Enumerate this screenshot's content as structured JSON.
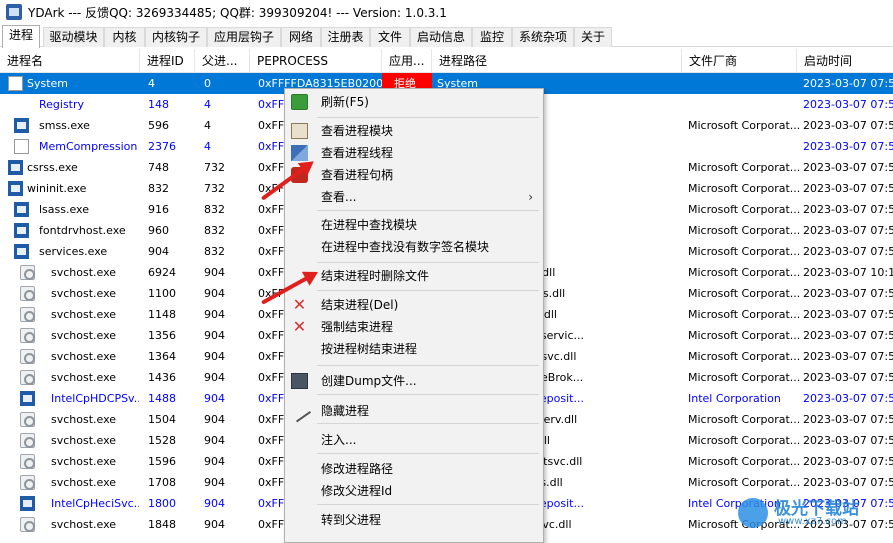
{
  "window": {
    "title": "YDArk --- 反馈QQ: 3269334485; QQ群: 399309204! --- Version: 1.0.3.1"
  },
  "tabs": [
    "进程",
    "驱动模块",
    "内核",
    "内核钩子",
    "应用层钩子",
    "网络",
    "注册表",
    "文件",
    "启动信息",
    "监控",
    "系统杂项",
    "关于"
  ],
  "columns": [
    "进程名",
    "进程ID",
    "父进...",
    "PEPROCESS",
    "应用...",
    "进程路径",
    "文件厂商",
    "启动时间"
  ],
  "rows": [
    {
      "name": "System",
      "pid": "4",
      "ppid": "0",
      "peprocess": "0xFFFFDA8315EB0200",
      "access": "拒绝",
      "path": "System",
      "vendor": "",
      "time": "2023-03-07 07:56:",
      "icon": "doc-icon",
      "blue": false,
      "selected": true
    },
    {
      "name": "Registry",
      "pid": "148",
      "ppid": "4",
      "peprocess": "0xFF",
      "access": "",
      "path": "",
      "vendor": "",
      "time": "2023-03-07 07:56:",
      "icon": "none",
      "blue": true,
      "selected": false
    },
    {
      "name": "smss.exe",
      "pid": "596",
      "ppid": "4",
      "peprocess": "0xFF",
      "access": "",
      "path": "2\\smss.exe",
      "vendor": "Microsoft Corporat...",
      "time": "2023-03-07 07:56:",
      "icon": "exe-icon",
      "blue": false,
      "selected": false
    },
    {
      "name": "MemCompression",
      "pid": "2376",
      "ppid": "4",
      "peprocess": "0xFF",
      "access": "",
      "path": "",
      "vendor": "",
      "time": "2023-03-07 07:56:",
      "icon": "doc-icon",
      "blue": true,
      "selected": false
    },
    {
      "name": "csrss.exe",
      "pid": "748",
      "ppid": "732",
      "peprocess": "0xFF",
      "access": "",
      "path": "2\\csrss.exe",
      "vendor": "Microsoft Corporat...",
      "time": "2023-03-07 07:56:",
      "icon": "exe-icon",
      "blue": false,
      "selected": false
    },
    {
      "name": "wininit.exe",
      "pid": "832",
      "ppid": "732",
      "peprocess": "0xFF",
      "access": "",
      "path": "2\\wininit.exe",
      "vendor": "Microsoft Corporat...",
      "time": "2023-03-07 07:56:",
      "icon": "exe-icon",
      "blue": false,
      "selected": false
    },
    {
      "name": "lsass.exe",
      "pid": "916",
      "ppid": "832",
      "peprocess": "0xFF",
      "access": "",
      "path": "2\\lsass.exe",
      "vendor": "Microsoft Corporat...",
      "time": "2023-03-07 07:56:",
      "icon": "exe-icon",
      "blue": false,
      "selected": false
    },
    {
      "name": "fontdrvhost.exe",
      "pid": "960",
      "ppid": "832",
      "peprocess": "0xFF",
      "access": "",
      "path": "2\\fontdrvhost.exe",
      "vendor": "Microsoft Corporat...",
      "time": "2023-03-07 07:56:",
      "icon": "exe-icon",
      "blue": false,
      "selected": false
    },
    {
      "name": "services.exe",
      "pid": "904",
      "ppid": "832",
      "peprocess": "0xFF",
      "access": "",
      "path": "2\\services.exe",
      "vendor": "Microsoft Corporat...",
      "time": "2023-03-07 07:56:",
      "icon": "exe-icon",
      "blue": false,
      "selected": false
    },
    {
      "name": "svchost.exe",
      "pid": "6924",
      "ppid": "904",
      "peprocess": "0xFF",
      "access": "",
      "path": "ows\\system32\\wdi.dll",
      "vendor": "Microsoft Corporat...",
      "time": "2023-03-07 10:18:",
      "icon": "svc-icon",
      "blue": false,
      "selected": false
    },
    {
      "name": "svchost.exe",
      "pid": "1100",
      "ppid": "904",
      "peprocess": "0xFF",
      "access": "",
      "path": "ows\\system32\\rpcss.dll",
      "vendor": "Microsoft Corporat...",
      "time": "2023-03-07 07:56:",
      "icon": "svc-icon",
      "blue": false,
      "selected": false
    },
    {
      "name": "svchost.exe",
      "pid": "1148",
      "ppid": "904",
      "peprocess": "0xFF",
      "access": "",
      "path": "ows\\System32\\lsm.dll",
      "vendor": "Microsoft Corporat...",
      "time": "2023-03-07 07:56:",
      "icon": "svc-icon",
      "blue": false,
      "selected": false
    },
    {
      "name": "svchost.exe",
      "pid": "1356",
      "ppid": "904",
      "peprocess": "0xFF",
      "access": "",
      "path": "ows\\System32\\ncbservic...",
      "vendor": "Microsoft Corporat...",
      "time": "2023-03-07 07:56:",
      "icon": "svc-icon",
      "blue": false,
      "selected": false
    },
    {
      "name": "svchost.exe",
      "pid": "1364",
      "ppid": "904",
      "peprocess": "0xFF",
      "access": "",
      "path": "ows\\system32\\profsvc.dll",
      "vendor": "Microsoft Corporat...",
      "time": "2023-03-07 07:56:",
      "icon": "svc-icon",
      "blue": false,
      "selected": false
    },
    {
      "name": "svchost.exe",
      "pid": "1436",
      "ppid": "904",
      "peprocess": "0xFF",
      "access": "",
      "path": "ows\\System32\\TimeBrok...",
      "vendor": "Microsoft Corporat...",
      "time": "2023-03-07 07:56:",
      "icon": "svc-icon",
      "blue": false,
      "selected": false
    },
    {
      "name": "IntelCpHDCPSv...",
      "pid": "1488",
      "ppid": "904",
      "peprocess": "0xFF",
      "access": "",
      "path": "2\\DriverStore\\FileReposit...",
      "vendor": "Intel Corporation",
      "time": "2023-03-07 07:56:",
      "icon": "exe-icon",
      "blue": true,
      "selected": false
    },
    {
      "name": "svchost.exe",
      "pid": "1504",
      "ppid": "904",
      "peprocess": "0xFF",
      "access": "",
      "path": "ows\\System32\\hidserv.dll",
      "vendor": "Microsoft Corporat...",
      "time": "2023-03-07 07:56:",
      "icon": "svc-icon",
      "blue": false,
      "selected": false
    },
    {
      "name": "svchost.exe",
      "pid": "1528",
      "ppid": "904",
      "peprocess": "0xFF",
      "access": "",
      "path": "ows\\System32\\es.dll",
      "vendor": "Microsoft Corporat...",
      "time": "2023-03-07 07:56:",
      "icon": "svc-icon",
      "blue": false,
      "selected": false
    },
    {
      "name": "svchost.exe",
      "pid": "1596",
      "ppid": "904",
      "peprocess": "0xFF",
      "access": "",
      "path": "ows\\System32\\wevtsvc.dll",
      "vendor": "Microsoft Corporat...",
      "time": "2023-03-07 07:56:",
      "icon": "svc-icon",
      "blue": false,
      "selected": false
    },
    {
      "name": "svchost.exe",
      "pid": "1708",
      "ppid": "904",
      "peprocess": "0xFF",
      "access": "",
      "path": "ows\\System32\\sens.dll",
      "vendor": "Microsoft Corporat...",
      "time": "2023-03-07 07:56:",
      "icon": "svc-icon",
      "blue": false,
      "selected": false
    },
    {
      "name": "IntelCpHeciSvc...",
      "pid": "1800",
      "ppid": "904",
      "peprocess": "0xFF",
      "access": "",
      "path": "2\\DriverStore\\FileReposit...",
      "vendor": "Intel Corporation",
      "time": "2023-03-07 07:56:",
      "icon": "exe-icon",
      "blue": true,
      "selected": false
    },
    {
      "name": "svchost.exe",
      "pid": "1848",
      "ppid": "904",
      "peprocess": "0xFF",
      "access": "",
      "path": "ows\\System32\\nsisvc.dll",
      "vendor": "Microsoft Corporat...",
      "time": "2023-03-07 07:56:",
      "icon": "svc-icon",
      "blue": false,
      "selected": false
    }
  ],
  "context_menu": {
    "items": [
      {
        "label": "刷新(F5)",
        "icon": "refresh-icon"
      },
      {
        "label": "查看进程模块",
        "icon": "module-icon"
      },
      {
        "label": "查看进程线程",
        "icon": "thread-icon"
      },
      {
        "label": "查看进程句柄",
        "icon": "handle-icon"
      },
      {
        "label": "查看...",
        "icon": "",
        "submenu": "›"
      },
      {
        "label": "在进程中查找模块",
        "icon": ""
      },
      {
        "label": "在进程中查找没有数字签名模块",
        "icon": ""
      },
      {
        "label": "结束进程时删除文件",
        "icon": ""
      },
      {
        "label": "结束进程(Del)",
        "icon": "close-icon"
      },
      {
        "label": "强制结束进程",
        "icon": "close-icon"
      },
      {
        "label": "按进程树结束进程",
        "icon": ""
      },
      {
        "label": "创建Dump文件...",
        "icon": "dump-icon"
      },
      {
        "label": "隐藏进程",
        "icon": "hide-icon"
      },
      {
        "label": "注入...",
        "icon": ""
      },
      {
        "label": "修改进程路径",
        "icon": ""
      },
      {
        "label": "修改父进程Id",
        "icon": ""
      },
      {
        "label": "转到父进程",
        "icon": ""
      }
    ],
    "close_glyph": "✕",
    "colors": {
      "accent": "#0078d7",
      "danger": "#d83030",
      "arrow": "#e0201d"
    }
  },
  "watermark": {
    "text": "极光下载站",
    "url": "www.xz7.com"
  }
}
